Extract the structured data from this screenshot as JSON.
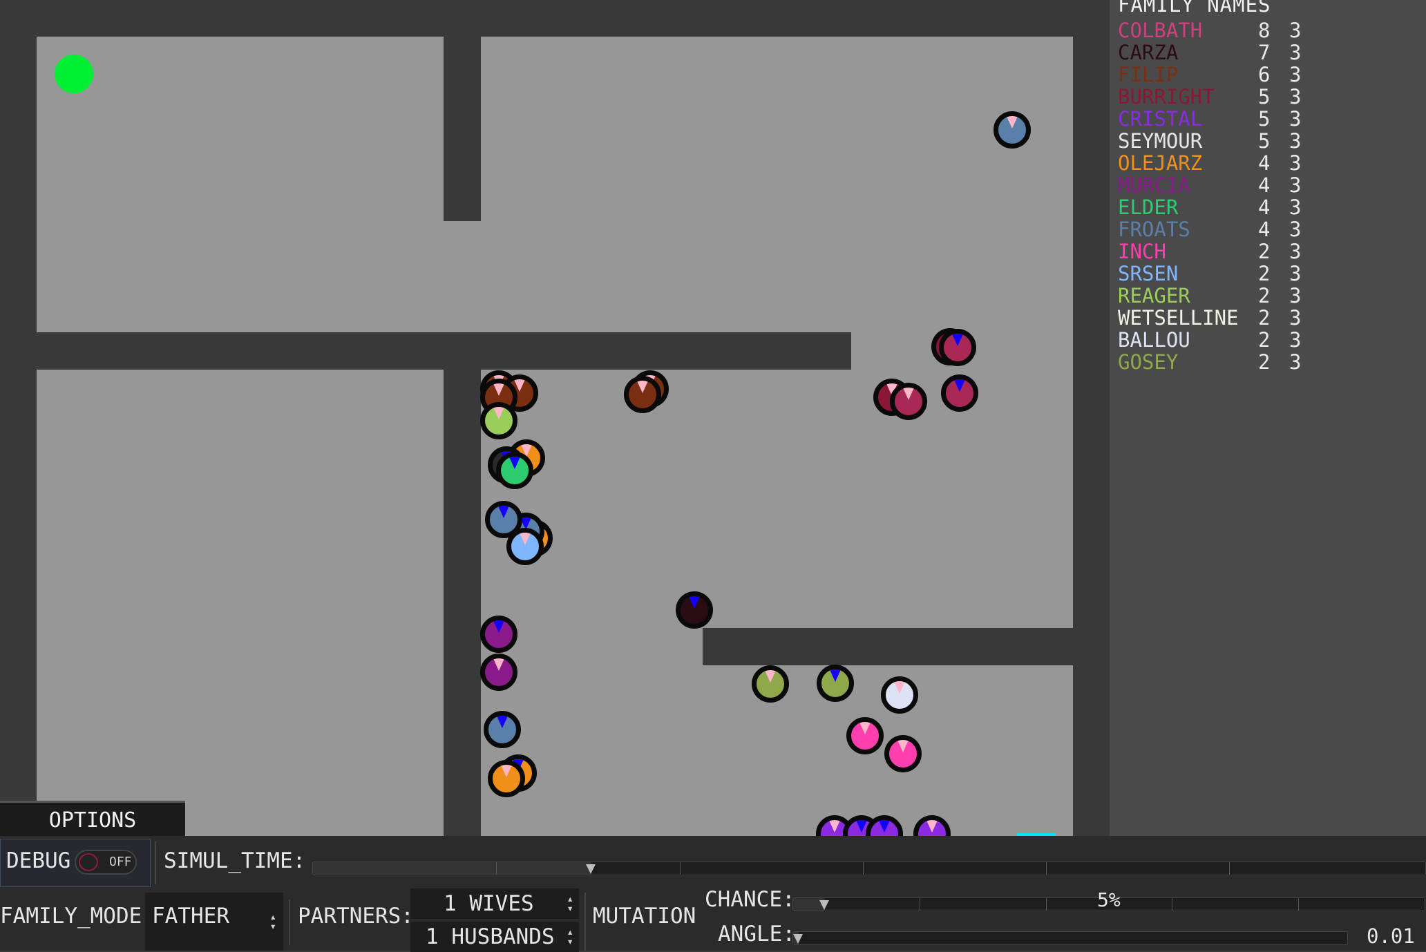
{
  "family_panel": {
    "title": "FAMILY NAMES",
    "families": [
      {
        "name": "COLBATH",
        "count": "8",
        "gen": "3",
        "color": "#d23f7e"
      },
      {
        "name": "CARZA",
        "count": "7",
        "gen": "3",
        "color": "#2a0d12"
      },
      {
        "name": "FILIP",
        "count": "6",
        "gen": "3",
        "color": "#7a2f12"
      },
      {
        "name": "BURRIGHT",
        "count": "5",
        "gen": "3",
        "color": "#8a1738"
      },
      {
        "name": "CRISTAL",
        "count": "5",
        "gen": "3",
        "color": "#8a2be2"
      },
      {
        "name": "SEYMOUR",
        "count": "5",
        "gen": "3",
        "color": "#e6e6e6"
      },
      {
        "name": "OLEJARZ",
        "count": "4",
        "gen": "3",
        "color": "#f0901a"
      },
      {
        "name": "MURCIA",
        "count": "4",
        "gen": "3",
        "color": "#8b1a8b"
      },
      {
        "name": "ELDER",
        "count": "4",
        "gen": "3",
        "color": "#2ecc71"
      },
      {
        "name": "FROATS",
        "count": "4",
        "gen": "3",
        "color": "#5a7fa8"
      },
      {
        "name": "INCH",
        "count": "2",
        "gen": "3",
        "color": "#ff3fae"
      },
      {
        "name": "SRSEN",
        "count": "2",
        "gen": "3",
        "color": "#7fb6ff"
      },
      {
        "name": "REAGER",
        "count": "2",
        "gen": "3",
        "color": "#9acd5a"
      },
      {
        "name": "WETSELLINE",
        "count": "2",
        "gen": "3",
        "color": "#f2f2e6"
      },
      {
        "name": "BALLOU",
        "count": "2",
        "gen": "3",
        "color": "#dde2f5"
      },
      {
        "name": "GOSEY",
        "count": "2",
        "gen": "3",
        "color": "#8ea84a"
      }
    ]
  },
  "options_tab": {
    "label": "OPTIONS"
  },
  "controls": {
    "debug_label": "DEBUG",
    "debug_state": "OFF",
    "simul_time_label": "SIMUL_TIME:",
    "simul_time_level": 0.25,
    "family_mode_label": "FAMILY_MODE:",
    "family_mode_value": "FATHER",
    "partners_label": "PARTNERS:",
    "wives_value": "1 WIVES",
    "husbands_value": "1 HUSBANDS",
    "mutation_label": "MUTATION",
    "chance_label": "CHANCE:",
    "chance_value": "5%",
    "chance_level": 0.05,
    "angle_label": "ANGLE:",
    "angle_value": "0.01",
    "angle_level": 0.01
  },
  "colors": {
    "arena_floor": "#979797",
    "wall": "#393939",
    "goal": "#00ee33",
    "female_marker": "#ffb6c8",
    "male_marker": "#1400ff",
    "panel_bg": "#4a4a4a"
  }
}
